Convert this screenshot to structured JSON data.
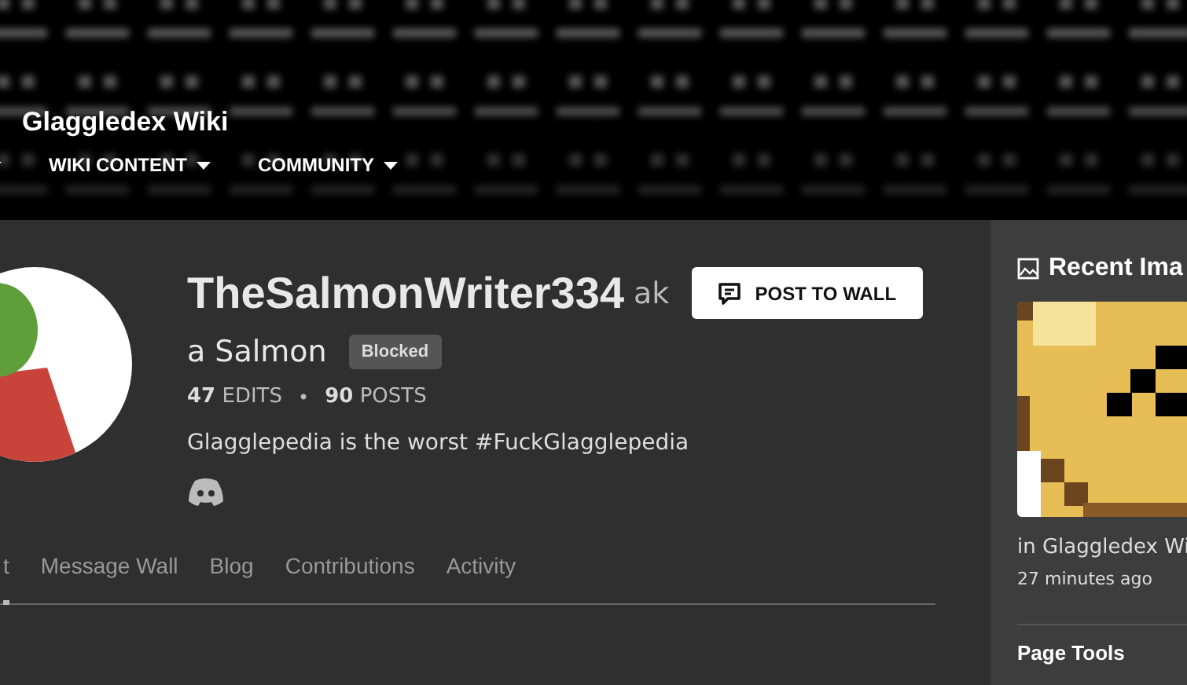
{
  "header": {
    "wiki_title": "Glaggledex Wiki",
    "nav": [
      {
        "kind": "caret"
      },
      {
        "kind": "menu",
        "label": "WIKI CONTENT"
      },
      {
        "kind": "menu",
        "label": "COMMUNITY"
      }
    ]
  },
  "profile": {
    "username": "TheSalmonWriter334",
    "alias": "ak",
    "post_button": "POST TO WALL",
    "tagline": "a Salmon",
    "badge": "Blocked",
    "stats": [
      {
        "count": "47",
        "label": "EDITS"
      },
      {
        "count": "90",
        "label": "POSTS"
      }
    ],
    "separator": "•",
    "bio": "Glagglepedia is the worst #FuckGlagglepedia"
  },
  "tabs": [
    {
      "label": "t",
      "selected": true
    },
    {
      "label": "Message Wall",
      "selected": false
    },
    {
      "label": "Blog",
      "selected": false
    },
    {
      "label": "Contributions",
      "selected": false
    },
    {
      "label": "Activity",
      "selected": false
    }
  ],
  "sidebar": {
    "title": "Recent Ima",
    "location": "in Glaggledex Wi",
    "time": "27 minutes ago",
    "next_title": "Page Tools"
  }
}
